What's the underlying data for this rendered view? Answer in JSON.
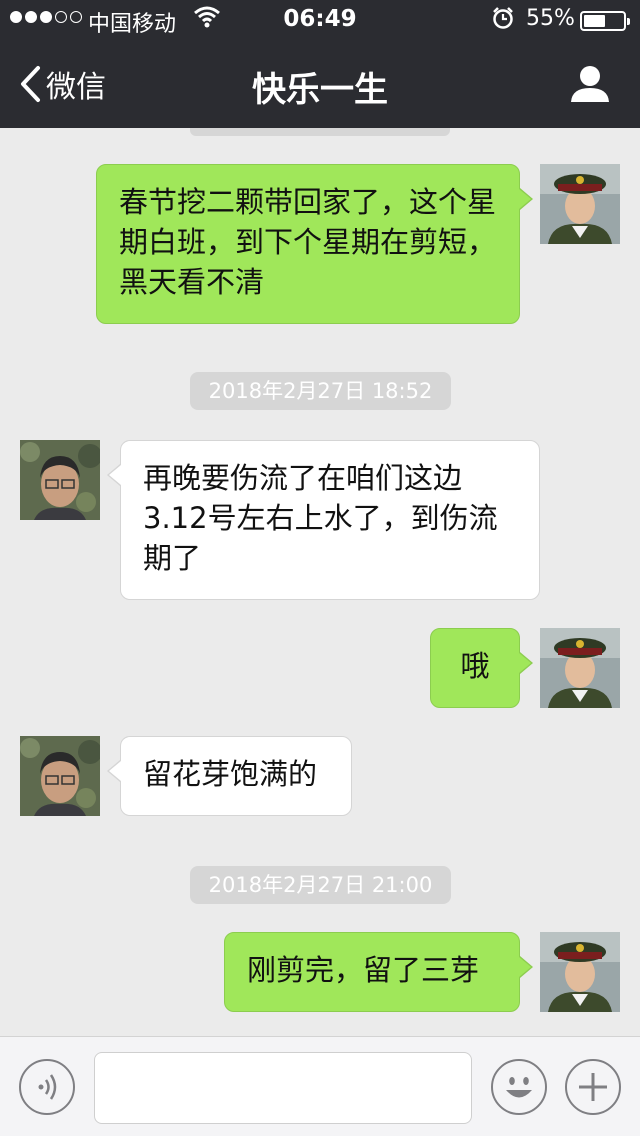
{
  "status": {
    "carrier": "中国移动",
    "time": "06:49",
    "battery_pct": "55%",
    "battery_level": 0.55,
    "signal_bars": 3
  },
  "nav": {
    "back_label": "微信",
    "title": "快乐一生"
  },
  "messages": [
    {
      "sender": "me",
      "text": "春节挖二颗带回家了，这个星期白班，到下个星期在剪短，黑天看不清"
    },
    {
      "sender": "timestamp",
      "text": "2018年2月27日 18:52"
    },
    {
      "sender": "other",
      "text": "再晚要伤流了在咱们这边3.12号左右上水了，到伤流期了"
    },
    {
      "sender": "me",
      "text": "哦"
    },
    {
      "sender": "other",
      "text": "留花芽饱满的"
    },
    {
      "sender": "timestamp",
      "text": "2018年2月27日 21:00"
    },
    {
      "sender": "me",
      "text": "刚剪完，留了三芽"
    }
  ],
  "input": {
    "voice_icon": "voice-icon",
    "emoji_icon": "emoji-icon",
    "plus_icon": "plus-icon"
  },
  "colors": {
    "nav_bg": "#2b2c31",
    "chat_bg": "#ebebeb",
    "bubble_me": "#a0e75a",
    "bubble_other": "#ffffff",
    "timestamp_bg": "#d6d6d6"
  }
}
